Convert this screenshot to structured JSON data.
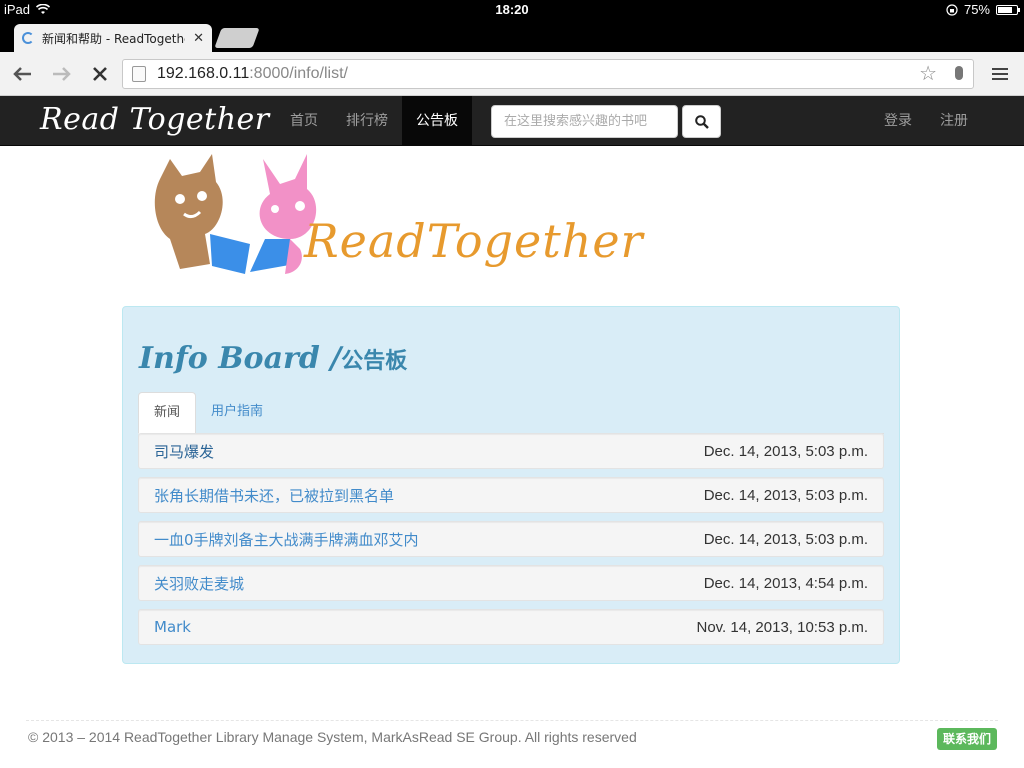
{
  "status_bar": {
    "device": "iPad",
    "time": "18:20",
    "battery": "75%",
    "battery_level": 0.75
  },
  "browser": {
    "tab_title": "新闻和帮助 - ReadTogether",
    "url_host": "192.168.0.11",
    "url_path": ":8000/info/list/"
  },
  "navbar": {
    "brand": "Read Together",
    "links": [
      "首页",
      "排行榜",
      "公告板"
    ],
    "active_index": 2,
    "search_placeholder": "在这里搜索感兴趣的书吧",
    "login": "登录",
    "register": "注册"
  },
  "logo": {
    "text": "ReadTogether"
  },
  "panel": {
    "title": "Info Board /",
    "subtitle": "公告板",
    "tabs": [
      "新闻",
      "用户指南"
    ],
    "active_tab": 0,
    "items": [
      {
        "title": "司马爆发",
        "date": "Dec. 14, 2013, 5:03 p.m."
      },
      {
        "title": "张角长期借书未还，已被拉到黑名单",
        "date": "Dec. 14, 2013, 5:03 p.m."
      },
      {
        "title": "一血0手牌刘备主大战满手牌满血邓艾内",
        "date": "Dec. 14, 2013, 5:03 p.m."
      },
      {
        "title": "关羽败走麦城",
        "date": "Dec. 14, 2013, 4:54 p.m."
      },
      {
        "title": "Mark",
        "date": "Nov. 14, 2013, 10:53 p.m."
      }
    ]
  },
  "footer": {
    "copyright": "© 2013 – 2014 ReadTogether Library Manage System, MarkAsRead SE Group. All rights reserved",
    "contact": "联系我们"
  },
  "colors": {
    "navbar_bg": "#222222",
    "panel_bg": "#d9edf7",
    "link": "#428bca",
    "contact_bg": "#5cb85c",
    "logo_orange": "#e79a2e"
  }
}
